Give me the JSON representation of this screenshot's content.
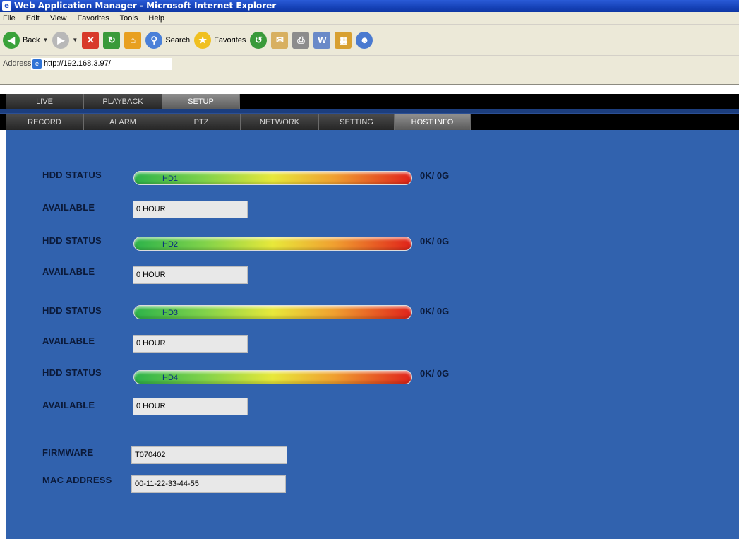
{
  "window": {
    "title": "Web Application Manager - Microsoft Internet Explorer"
  },
  "menu": [
    "File",
    "Edit",
    "View",
    "Favorites",
    "Tools",
    "Help"
  ],
  "toolbar": {
    "back_label": "Back",
    "search_label": "Search",
    "favorites_label": "Favorites"
  },
  "address": {
    "label": "Address",
    "url": "http://192.168.3.97/"
  },
  "nav_primary": [
    "LIVE",
    "PLAYBACK",
    "SETUP"
  ],
  "nav_secondary": [
    "RECORD",
    "ALARM",
    "PTZ",
    "NETWORK",
    "SETTING",
    "HOST INFO"
  ],
  "active_primary": "SETUP",
  "active_secondary": "HOST INFO",
  "hdd": [
    {
      "status_label": "HDD STATUS",
      "name": "HD1",
      "usage": "0K/ 0G",
      "available_label": "AVAILABLE",
      "available": "0 HOUR"
    },
    {
      "status_label": "HDD STATUS",
      "name": "HD2",
      "usage": "0K/ 0G",
      "available_label": "AVAILABLE",
      "available": "0 HOUR"
    },
    {
      "status_label": "HDD STATUS",
      "name": "HD3",
      "usage": "0K/ 0G",
      "available_label": "AVAILABLE",
      "available": "0 HOUR"
    },
    {
      "status_label": "HDD STATUS",
      "name": "HD4",
      "usage": "0K/ 0G",
      "available_label": "AVAILABLE",
      "available": "0 HOUR"
    }
  ],
  "firmware": {
    "label": "FIRMWARE",
    "value": "T070402"
  },
  "mac": {
    "label": "MAC ADDRESS",
    "value": "00-11-22-33-44-55"
  },
  "colors": {
    "content_bg": "#3162ae",
    "nav_bg": "#000000",
    "active_tab": "#7a7a7a"
  }
}
